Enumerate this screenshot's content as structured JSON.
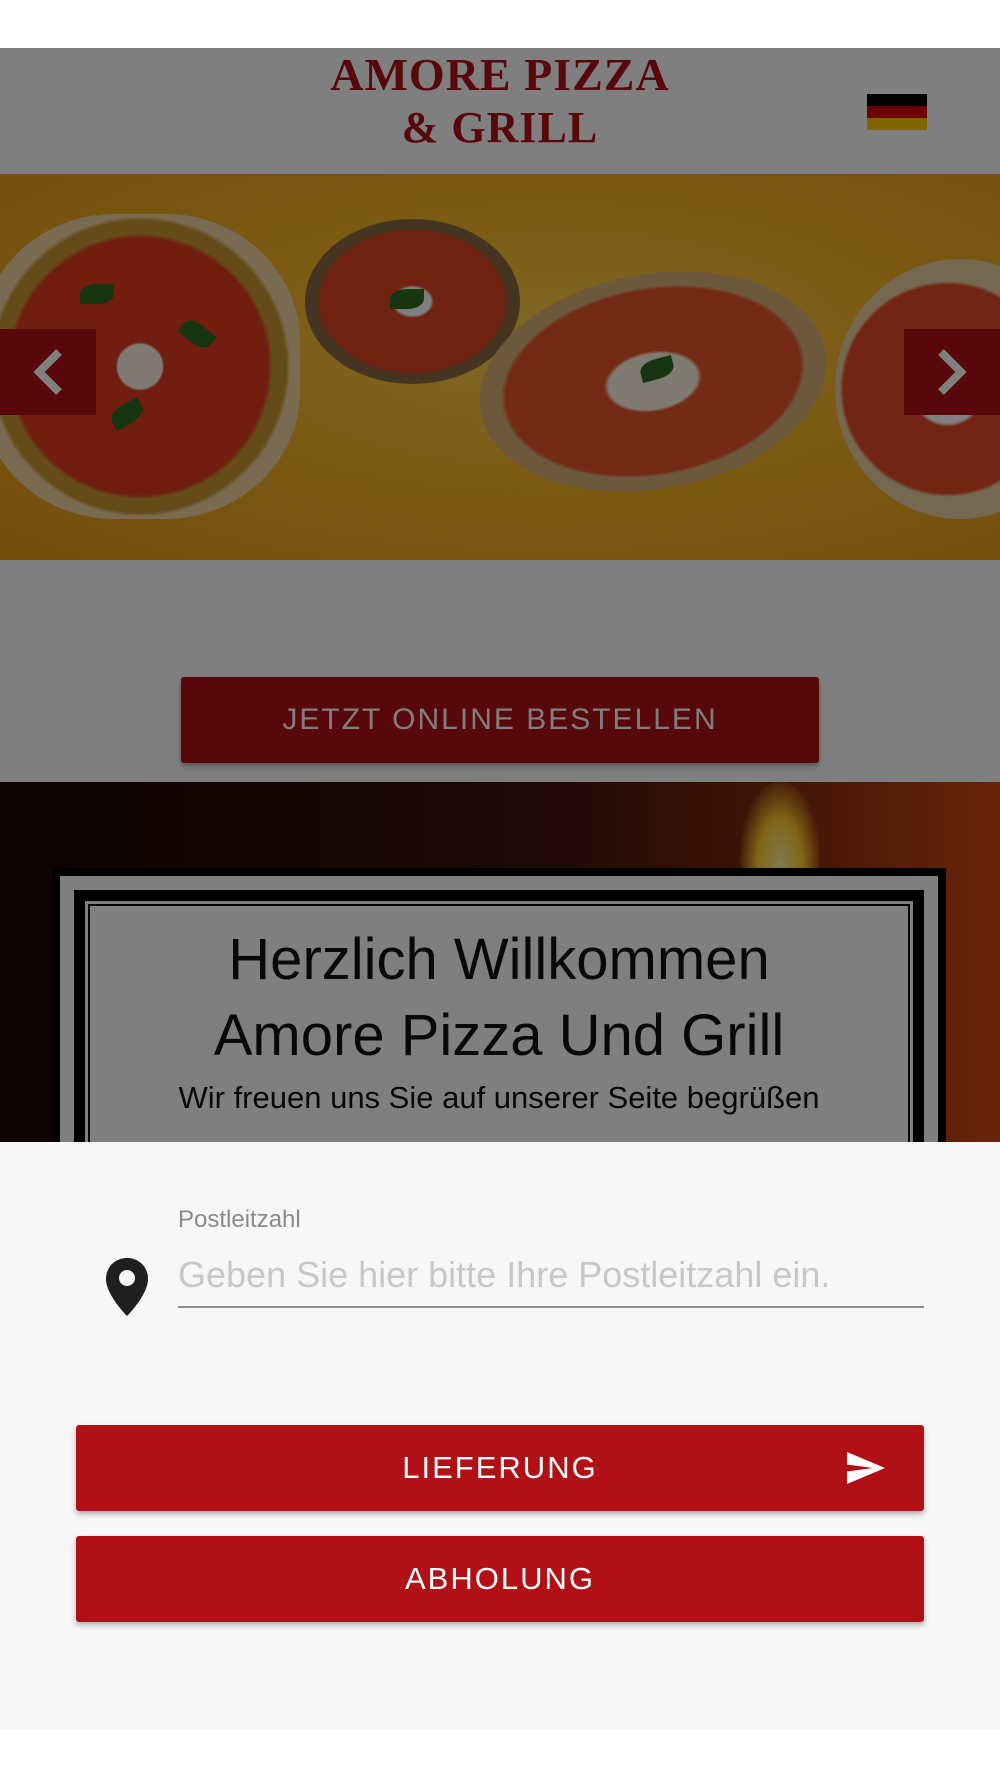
{
  "header": {
    "logo_line1": "AMORE PIZZA",
    "logo_line2": "& GRILL",
    "language_flag": "german-flag-icon"
  },
  "carousel": {
    "prev_icon": "chevron-left-icon",
    "next_icon": "chevron-right-icon"
  },
  "order": {
    "button_label": "JETZT ONLINE BESTELLEN"
  },
  "welcome": {
    "title_line1": "Herzlich Willkommen",
    "title_line2": "Amore Pizza Und Grill",
    "subtitle": "Wir freuen uns Sie auf unserer Seite begrüßen"
  },
  "sheet": {
    "zip_label": "Postleitzahl",
    "zip_placeholder": "Geben Sie hier bitte Ihre Postleitzahl ein.",
    "zip_value": "",
    "delivery_label": "LIEFERUNG",
    "pickup_label": "ABHOLUNG",
    "location_icon": "map-pin-icon",
    "send_icon": "send-icon"
  },
  "colors": {
    "accent": "#b11116",
    "sheet_background": "#f7f7f7",
    "overlay": "rgba(0,0,0,0.5)"
  }
}
